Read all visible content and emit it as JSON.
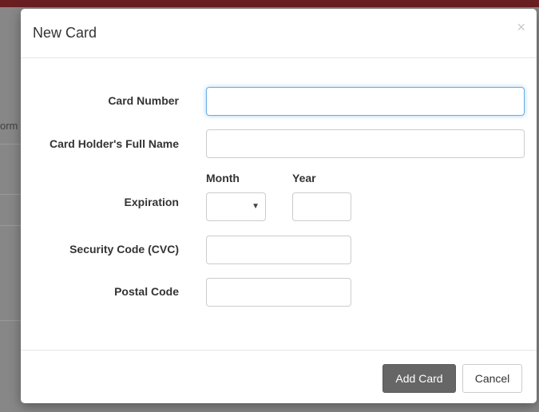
{
  "modal": {
    "title": "New Card",
    "close_glyph": "×"
  },
  "form": {
    "card_number": {
      "label": "Card Number",
      "value": "",
      "placeholder": ""
    },
    "card_holder": {
      "label": "Card Holder's Full Name",
      "value": "",
      "placeholder": ""
    },
    "expiration": {
      "label": "Expiration",
      "month_label": "Month",
      "year_label": "Year",
      "month_value": "",
      "year_value": ""
    },
    "cvc": {
      "label": "Security Code (CVC)",
      "value": "",
      "placeholder": ""
    },
    "postal_code": {
      "label": "Postal Code",
      "value": "",
      "placeholder": ""
    }
  },
  "footer": {
    "add_label": "Add Card",
    "cancel_label": "Cancel"
  },
  "background": {
    "partial_text": "orm"
  },
  "colors": {
    "topbar": "#6a1f21",
    "primary_button": "#666666",
    "focus_border": "#66afe9"
  },
  "icons": {
    "close": "close-icon",
    "select_caret": "caret-down-icon"
  }
}
